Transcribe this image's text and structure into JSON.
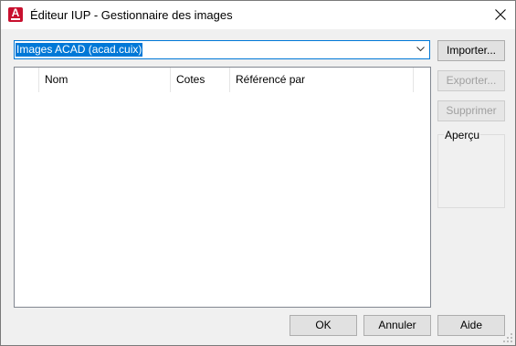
{
  "window": {
    "title": "Éditeur IUP - Gestionnaire des images"
  },
  "app_icon": {
    "letter": "A"
  },
  "source_select": {
    "value": "Images ACAD (acad.cuix)"
  },
  "image_list": {
    "columns": [
      "Nom",
      "Cotes",
      "Référencé par"
    ],
    "rows": []
  },
  "side_buttons": {
    "import": "Importer...",
    "export": "Exporter...",
    "delete": "Supprimer"
  },
  "preview": {
    "label": "Aperçu"
  },
  "footer": {
    "ok": "OK",
    "cancel": "Annuler",
    "help": "Aide"
  },
  "colors": {
    "accent": "#0078d7",
    "autocad_red": "#c8102e"
  }
}
